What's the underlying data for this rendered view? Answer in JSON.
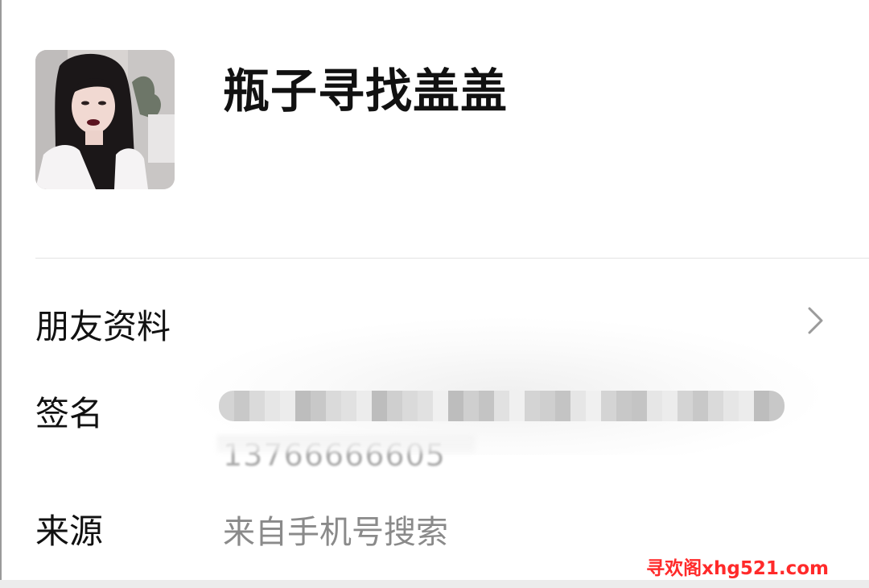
{
  "profile": {
    "name": "瓶子寻找盖盖",
    "avatar_icon": "profile-photo"
  },
  "rows": {
    "friend_info_label": "朋友资料",
    "signature_label": "签名",
    "signature_number": "13766666605",
    "source_label": "来源",
    "source_value": "来自手机号搜索"
  },
  "icons": {
    "chevron": "chevron-right-icon"
  },
  "watermark": {
    "text": "寻欢阁xhg521.com",
    "color": "#ff2a2a"
  },
  "colors": {
    "primary_text": "#111111",
    "secondary_text": "#8a8a8a",
    "divider": "#e3e3e3"
  }
}
